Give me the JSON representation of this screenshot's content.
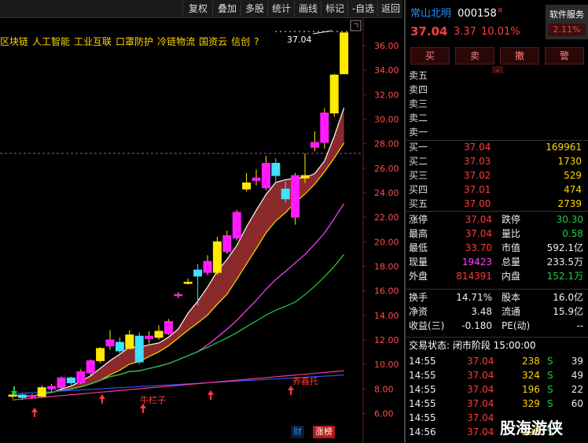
{
  "toolbar": {
    "buttons": [
      "复权",
      "叠加",
      "多股",
      "统计",
      "画线",
      "标记",
      "-自选",
      "返回"
    ]
  },
  "concept_tags": [
    "区块链",
    "人工智能",
    "工业互联",
    "口罩防护",
    "冷链物流",
    "国资云",
    "信创",
    "?"
  ],
  "chart_data": {
    "type": "candlestick",
    "y_axis_ticks": [
      "36.00",
      "34.00",
      "32.00",
      "30.00",
      "28.00",
      "26.00",
      "24.00",
      "22.00",
      "20.00",
      "18.00",
      "16.00",
      "14.00",
      "12.00",
      "10.00",
      "8.00",
      "6.00"
    ],
    "ylim": [
      5.0,
      37.6
    ],
    "last_price_label": "37.04",
    "reference_line": 27.2,
    "candles": [
      {
        "o": 7.4,
        "c": 7.5,
        "h": 7.7,
        "l": 7.2
      },
      {
        "o": 7.5,
        "c": 7.3,
        "h": 7.6,
        "l": 7.1
      },
      {
        "o": 7.35,
        "c": 7.45,
        "h": 7.6,
        "l": 7.2
      },
      {
        "o": 7.4,
        "c": 8.1,
        "h": 8.3,
        "l": 7.3
      },
      {
        "o": 8.0,
        "c": 8.2,
        "h": 8.4,
        "l": 7.8
      },
      {
        "o": 8.1,
        "c": 8.9,
        "h": 9.0,
        "l": 7.9
      },
      {
        "o": 8.9,
        "c": 8.5,
        "h": 9.0,
        "l": 8.3
      },
      {
        "o": 8.5,
        "c": 9.4,
        "h": 9.6,
        "l": 8.4
      },
      {
        "o": 9.3,
        "c": 10.3,
        "h": 10.4,
        "l": 9.1
      },
      {
        "o": 10.3,
        "c": 11.3,
        "h": 11.4,
        "l": 10.1
      },
      {
        "o": 11.5,
        "c": 12.0,
        "h": 12.8,
        "l": 11.2
      },
      {
        "o": 11.8,
        "c": 11.1,
        "h": 12.2,
        "l": 10.9
      },
      {
        "o": 11.3,
        "c": 12.4,
        "h": 12.8,
        "l": 11.2
      },
      {
        "o": 12.3,
        "c": 10.2,
        "h": 12.6,
        "l": 10.0
      },
      {
        "o": 12.1,
        "c": 12.3,
        "h": 12.7,
        "l": 11.7
      },
      {
        "o": 12.2,
        "c": 12.7,
        "h": 13.2,
        "l": 12.0
      },
      {
        "o": 12.5,
        "c": 13.5,
        "h": 13.7,
        "l": 12.4
      },
      {
        "o": 15.6,
        "c": 15.7,
        "h": 15.9,
        "l": 15.4
      },
      {
        "o": 16.6,
        "c": 16.7,
        "h": 17.0,
        "l": 16.5
      },
      {
        "o": 17.7,
        "c": 17.2,
        "h": 18.2,
        "l": 14.8
      },
      {
        "o": 17.5,
        "c": 18.4,
        "h": 18.9,
        "l": 17.3
      },
      {
        "o": 17.5,
        "c": 20.0,
        "h": 20.4,
        "l": 17.3
      },
      {
        "o": 19.2,
        "c": 20.5,
        "h": 20.9,
        "l": 19.0
      },
      {
        "o": 20.3,
        "c": 22.4,
        "h": 22.6,
        "l": 20.1
      },
      {
        "o": 24.3,
        "c": 24.8,
        "h": 25.6,
        "l": 24.1
      },
      {
        "o": 25.0,
        "c": 25.2,
        "h": 25.9,
        "l": 24.6
      },
      {
        "o": 24.4,
        "c": 26.4,
        "h": 27.0,
        "l": 24.2
      },
      {
        "o": 26.4,
        "c": 25.4,
        "h": 26.8,
        "l": 24.8
      },
      {
        "o": 24.3,
        "c": 23.5,
        "h": 24.9,
        "l": 23.2
      },
      {
        "o": 22.0,
        "c": 25.4,
        "h": 25.6,
        "l": 21.4
      },
      {
        "o": 25.2,
        "c": 25.4,
        "h": 27.2,
        "l": 24.8
      },
      {
        "o": 27.7,
        "c": 28.1,
        "h": 29.0,
        "l": 27.4
      },
      {
        "o": 28.1,
        "c": 30.5,
        "h": 30.9,
        "l": 27.6
      },
      {
        "o": 30.5,
        "c": 33.6,
        "h": 33.7,
        "l": 30.2
      },
      {
        "o": 33.7,
        "c": 37.04,
        "h": 37.04,
        "l": 33.7
      }
    ],
    "annotations": [
      "牛栏子",
      "养鑫托"
    ],
    "bottom_tags": [
      "财",
      "涨榜"
    ]
  },
  "stock": {
    "name": "常山北明",
    "code": "000158",
    "badge": "R",
    "price": "37.04",
    "change": "3.37",
    "change_pct": "10.01%",
    "service_label": "软件服务",
    "service_pct": "2.11%"
  },
  "trade_buttons": [
    "买",
    "卖",
    "撤",
    "警"
  ],
  "sell_levels": [
    {
      "label": "卖五",
      "price": "",
      "vol": ""
    },
    {
      "label": "卖四",
      "price": "",
      "vol": ""
    },
    {
      "label": "卖三",
      "price": "",
      "vol": ""
    },
    {
      "label": "卖二",
      "price": "",
      "vol": ""
    },
    {
      "label": "卖一",
      "price": "",
      "vol": ""
    }
  ],
  "buy_levels": [
    {
      "label": "买一",
      "price": "37.04",
      "vol": "169961"
    },
    {
      "label": "买二",
      "price": "37.03",
      "vol": "1730"
    },
    {
      "label": "买三",
      "price": "37.02",
      "vol": "529"
    },
    {
      "label": "买四",
      "price": "37.01",
      "vol": "474"
    },
    {
      "label": "买五",
      "price": "37.00",
      "vol": "2739"
    }
  ],
  "quote": {
    "limit_up_label": "涨停",
    "limit_up": "37.04",
    "limit_down_label": "跌停",
    "limit_down": "30.30",
    "high_label": "最高",
    "high": "37.04",
    "vol_ratio_label": "量比",
    "vol_ratio": "0.58",
    "low_label": "最低",
    "low": "33.70",
    "mktcap_label": "市值",
    "mktcap": "592.1亿",
    "last_vol_label": "现量",
    "last_vol": "19423",
    "total_vol_label": "总量",
    "total_vol": "233.5万",
    "outer_label": "外盘",
    "outer": "814391",
    "inner_label": "内盘",
    "inner": "152.1万",
    "turnover_label": "换手",
    "turnover": "14.71%",
    "equity_label": "股本",
    "equity": "16.0亿",
    "nav_label": "净资",
    "nav": "3.48",
    "float_label": "流通",
    "float": "15.9亿",
    "eps_label": "收益(三)",
    "eps": "-0.180",
    "pe_label": "PE(动)",
    "pe": "--"
  },
  "trading_status": "交易状态: 闭市阶段 15:00:00",
  "ticks": [
    {
      "time": "14:55",
      "price": "37.04",
      "vol": "238",
      "side": "S",
      "n": "39"
    },
    {
      "time": "14:55",
      "price": "37.04",
      "vol": "324",
      "side": "S",
      "n": "49"
    },
    {
      "time": "14:55",
      "price": "37.04",
      "vol": "196",
      "side": "S",
      "n": "22"
    },
    {
      "time": "14:55",
      "price": "37.04",
      "vol": "329",
      "side": "S",
      "n": "60"
    },
    {
      "time": "14:55",
      "price": "37.04",
      "vol": "",
      "side": "",
      "n": ""
    },
    {
      "time": "14:56",
      "price": "37.04",
      "vol": "293",
      "side": "S",
      "n": ""
    }
  ],
  "watermark": "股海游侠"
}
